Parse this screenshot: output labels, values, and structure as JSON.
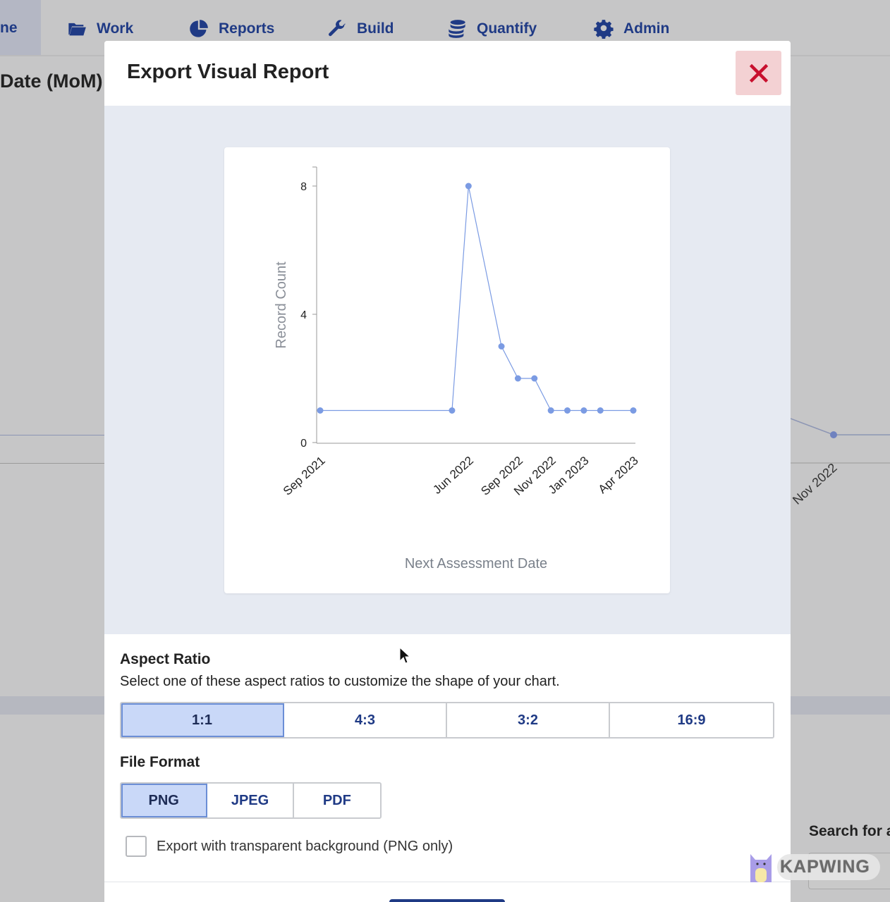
{
  "nav": {
    "home_partial": "ne",
    "items": [
      {
        "label": "Work",
        "icon": "folder-icon"
      },
      {
        "label": "Reports",
        "icon": "pie-chart-icon"
      },
      {
        "label": "Build",
        "icon": "wrench-icon"
      },
      {
        "label": "Quantify",
        "icon": "coins-icon"
      },
      {
        "label": "Admin",
        "icon": "gear-icon"
      }
    ]
  },
  "background": {
    "page_title_partial": "Date (MoM)",
    "x_tick_partial": "Nov 2022",
    "search_label_partial": "Search for a"
  },
  "modal": {
    "title": "Export Visual Report",
    "close_icon": "close-icon",
    "aspect": {
      "label": "Aspect Ratio",
      "description": "Select one of these aspect ratios to customize the shape of your chart.",
      "options": [
        "1:1",
        "4:3",
        "3:2",
        "16:9"
      ],
      "selected": "1:1"
    },
    "format": {
      "label": "File Format",
      "options": [
        "PNG",
        "JPEG",
        "PDF"
      ],
      "selected": "PNG"
    },
    "transparent": {
      "label": "Export with transparent background (PNG only)",
      "checked": false
    }
  },
  "watermark": "KAPWING",
  "colors": {
    "accent": "#1f3a85",
    "series": "#7b9be3",
    "close_bg": "#f3d1d3",
    "close_x": "#c8102e",
    "selected_bg": "#c9d8f8"
  },
  "chart_data": {
    "type": "line",
    "title": "",
    "xlabel": "Next Assessment Date",
    "ylabel": "Record Count",
    "ylim": [
      0,
      8.5
    ],
    "yticks": [
      0,
      4,
      8
    ],
    "xticks": [
      "Sep 2021",
      "Jun 2022",
      "Sep 2022",
      "Nov 2022",
      "Jan 2023",
      "Apr 2023"
    ],
    "x": [
      "2021-09",
      "2022-05",
      "2022-06",
      "2022-08",
      "2022-09",
      "2022-10",
      "2022-11",
      "2022-12",
      "2023-01",
      "2023-02",
      "2023-04"
    ],
    "values": [
      1,
      1,
      8,
      3,
      2,
      2,
      1,
      1,
      1,
      1,
      1
    ],
    "grid": false
  }
}
